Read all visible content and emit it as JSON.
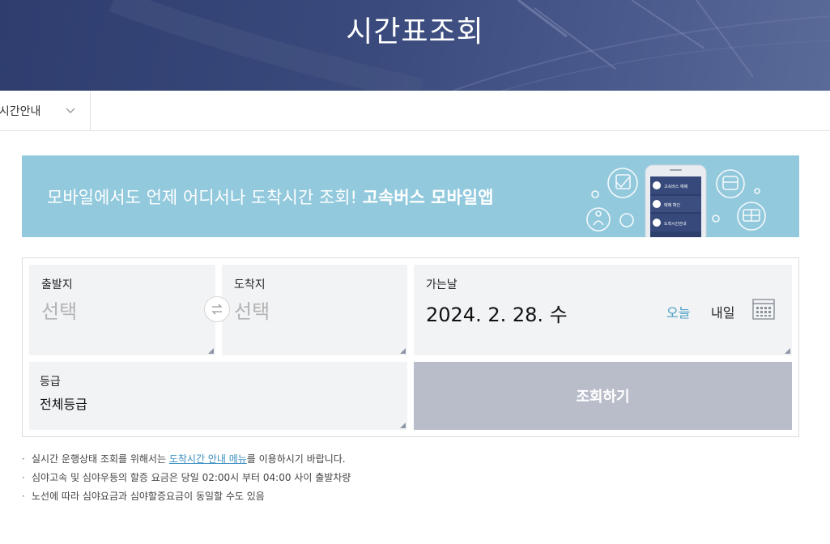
{
  "header": {
    "title": "시간표조회"
  },
  "breadcrumb": {
    "selected": "착시간안내"
  },
  "banner": {
    "text": "모바일에서도 언제 어디서나 도착시간 조회! ",
    "highlight": "고속버스 모바일앱",
    "phone_menu": [
      "고속버스 예매",
      "예매 확인",
      "도착시간안내"
    ]
  },
  "form": {
    "departure": {
      "label": "출발지",
      "placeholder": "선택"
    },
    "arrival": {
      "label": "도착지",
      "placeholder": "선택"
    },
    "date": {
      "label": "가는날",
      "value": "2024. 2. 28. 수",
      "today": "오늘",
      "tomorrow": "내일"
    },
    "grade": {
      "label": "등급",
      "value": "전체등급"
    },
    "search_button": "조회하기"
  },
  "notes": {
    "note1_prefix": "실시간 운행상태 조회를 위해서는 ",
    "note1_link": "도착시간 안내 메뉴",
    "note1_suffix": "를 이용하시기 바랍니다.",
    "note2": "심야고속 및 심야우등의 할증 요금은 당일 02:00시 부터 04:00 사이 출발차량",
    "note3": "노선에 따라 심야요금과 심야할증요금이 동일할 수도 있음"
  },
  "colors": {
    "header_bg": "#3a4a7c",
    "banner_bg": "#92c9dd",
    "field_bg": "#f2f3f5",
    "search_button_bg": "#b9bdca",
    "link": "#3b8fc1",
    "today_accent": "#4a9fc4"
  }
}
